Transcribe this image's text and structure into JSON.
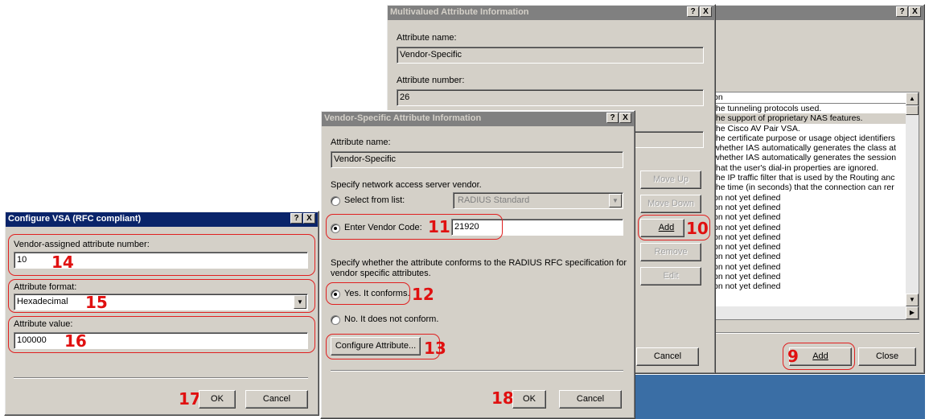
{
  "back_window": {
    "title_buttons": [
      "?",
      "X"
    ],
    "list_header": "on",
    "list_items": [
      "the tunneling protocols used.",
      "the support of proprietary NAS features.",
      "the Cisco AV Pair VSA.",
      "the certificate purpose or usage object identifiers",
      "whether IAS automatically generates the class at",
      "whether IAS automatically generates the session",
      "that the user's dial-in properties are ignored.",
      "the IP traffic filter that is used by the Routing anc",
      "the time (in seconds) that the connection can rer",
      "on not yet defined",
      "on not yet defined",
      "on not yet defined",
      "on not yet defined",
      "on not yet defined",
      "on not yet defined",
      "on not yet defined",
      "on not yet defined",
      "on not yet defined",
      "on not yet defined"
    ],
    "add_label": "Add",
    "close_label": "Close",
    "badge_add": "9"
  },
  "multivalued_window": {
    "title": "Multivalued Attribute Information",
    "title_buttons": [
      "?",
      "X"
    ],
    "attr_name_label": "Attribute name:",
    "attr_name_value": "Vendor-Specific",
    "attr_number_label": "Attribute number:",
    "attr_number_value": "26",
    "move_up": "Move Up",
    "move_down": "Move Down",
    "add": "Add",
    "remove": "Remove",
    "edit": "Edit",
    "cancel": "Cancel",
    "badge_add": "10"
  },
  "vsa_window": {
    "title": "Vendor-Specific Attribute Information",
    "title_buttons": [
      "?",
      "X"
    ],
    "attr_name_label": "Attribute name:",
    "attr_name_value": "Vendor-Specific",
    "vendor_prompt": "Specify network access server vendor.",
    "select_from_list": "Select from list:",
    "vendor_select_value": "RADIUS Standard",
    "enter_vendor_code": "Enter Vendor Code:",
    "vendor_code_value": "21920",
    "conform_prompt_1": "Specify whether the attribute conforms to the RADIUS RFC specification for",
    "conform_prompt_2": "vendor specific attributes.",
    "yes_conforms": "Yes. It conforms.",
    "no_conform": "No. It does not conform.",
    "configure_attribute": "Configure Attribute...",
    "ok": "OK",
    "cancel": "Cancel",
    "badge_vendor_code": "11",
    "badge_yes": "12",
    "badge_configure": "13",
    "badge_ok": "18"
  },
  "configure_window": {
    "title": "Configure VSA (RFC compliant)",
    "title_buttons": [
      "?",
      "X"
    ],
    "attr_number_label": "Vendor-assigned attribute number:",
    "attr_number_value": "10",
    "attr_format_label": "Attribute format:",
    "attr_format_value": "Hexadecimal",
    "attr_value_label": "Attribute value:",
    "attr_value_value": "100000",
    "ok": "OK",
    "cancel": "Cancel",
    "badge_number": "14",
    "badge_format": "15",
    "badge_value": "16",
    "badge_ok": "17"
  },
  "colors": {
    "active_title": "#0a246a",
    "inactive_title": "#808080",
    "dialog_face": "#d4d0c8",
    "annotation_red": "#e01010",
    "desktop_blue": "#3a6ea5"
  }
}
